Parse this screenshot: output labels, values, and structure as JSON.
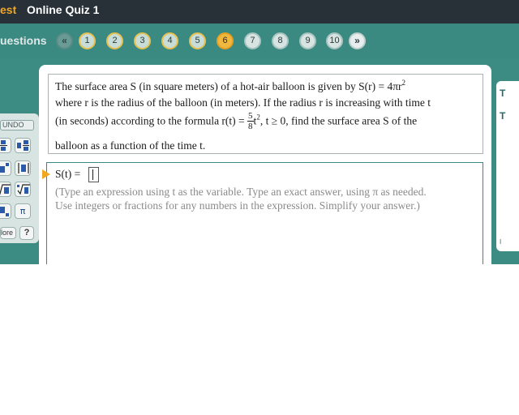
{
  "header": {
    "test_label": "est",
    "quiz_title": "Online Quiz 1"
  },
  "nav": {
    "questions_label": "uestions",
    "prev_label": "«",
    "next_label": "»",
    "questions": [
      "1",
      "2",
      "3",
      "4",
      "5",
      "6",
      "7",
      "8",
      "9",
      "10"
    ],
    "current": "6"
  },
  "toolbar": {
    "undo_label": "UNDO",
    "pi_label": "π",
    "more_label": "lore",
    "help_label": "?"
  },
  "question": {
    "line1": "The surface area S (in square meters) of a hot-air balloon is given by S(r) = 4πr",
    "line1_exp": "2",
    "line2": "where r is the radius of the balloon (in meters).  If the radius r is increasing with time t",
    "line3_pre": "(in seconds) according to the formula r(t) = ",
    "frac_num": "5",
    "frac_den": "8",
    "line3_t": "t",
    "line3_exp": "2",
    "line3_post": ",  t ≥ 0,  find the surface area S of the",
    "line4": "balloon as a function of the time t."
  },
  "answer": {
    "label": "S(t) =",
    "value": "",
    "instructions_line1": "(Type an expression using t as the variable.  Type an exact answer, using π as needed.",
    "instructions_line2": "Use integers or fractions for any numbers in the expression.  Simplify your answer.)"
  },
  "right_panel": {
    "t1": "T",
    "t2": "T",
    "t3": "I"
  },
  "colors": {
    "top_bar": "#283038",
    "teal": "#3d8c84",
    "accent": "#f0a820"
  }
}
